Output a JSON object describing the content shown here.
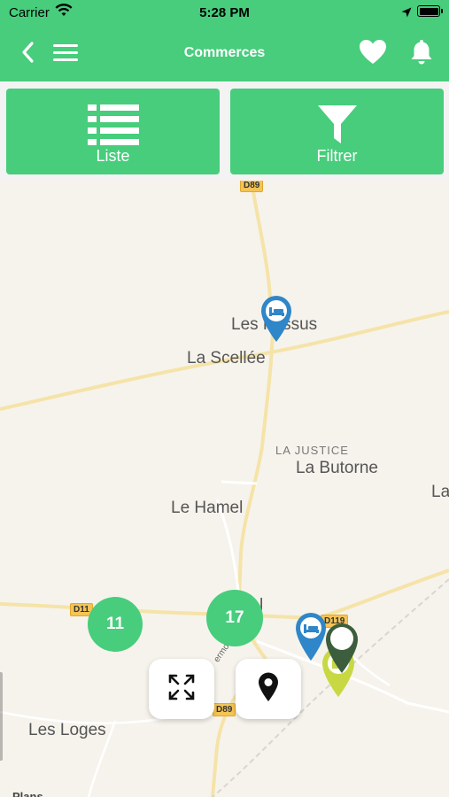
{
  "status_bar": {
    "carrier": "Carrier",
    "time": "5:28 PM",
    "icons": [
      "wifi-icon",
      "location-arrow-icon",
      "battery-icon"
    ]
  },
  "nav": {
    "title": "Commerces",
    "icons": [
      "back-chevron-icon",
      "hamburger-menu-icon",
      "heart-icon",
      "bell-icon"
    ]
  },
  "actions": {
    "list_label": "Liste",
    "filter_label": "Filtrer",
    "icons": [
      "list-icon",
      "funnel-icon"
    ]
  },
  "map": {
    "places": {
      "les_fossus": "Les Fossus",
      "la_scellee": "La Scellée",
      "la_justice": "LA JUSTICE",
      "la_butorne": "La Butorne",
      "le_hamel": "Le Hamel",
      "les_loges": "Les Loges",
      "la_edge": "La",
      "town_partial": "l"
    },
    "roads": {
      "d89_top": "D89",
      "d11": "D11",
      "d89_bottom": "D89",
      "d119": "D119",
      "rue_partial": "ermoz"
    },
    "clusters": {
      "left": "11",
      "center": "17"
    },
    "brand": "Plans",
    "controls": [
      "expand-icon",
      "location-pin-icon"
    ],
    "colors": {
      "accent": "#47cd7c",
      "pin_blue": "#2f86c8",
      "pin_dark_green": "#3c5e3c",
      "pin_yellow": "#c8d843"
    }
  }
}
